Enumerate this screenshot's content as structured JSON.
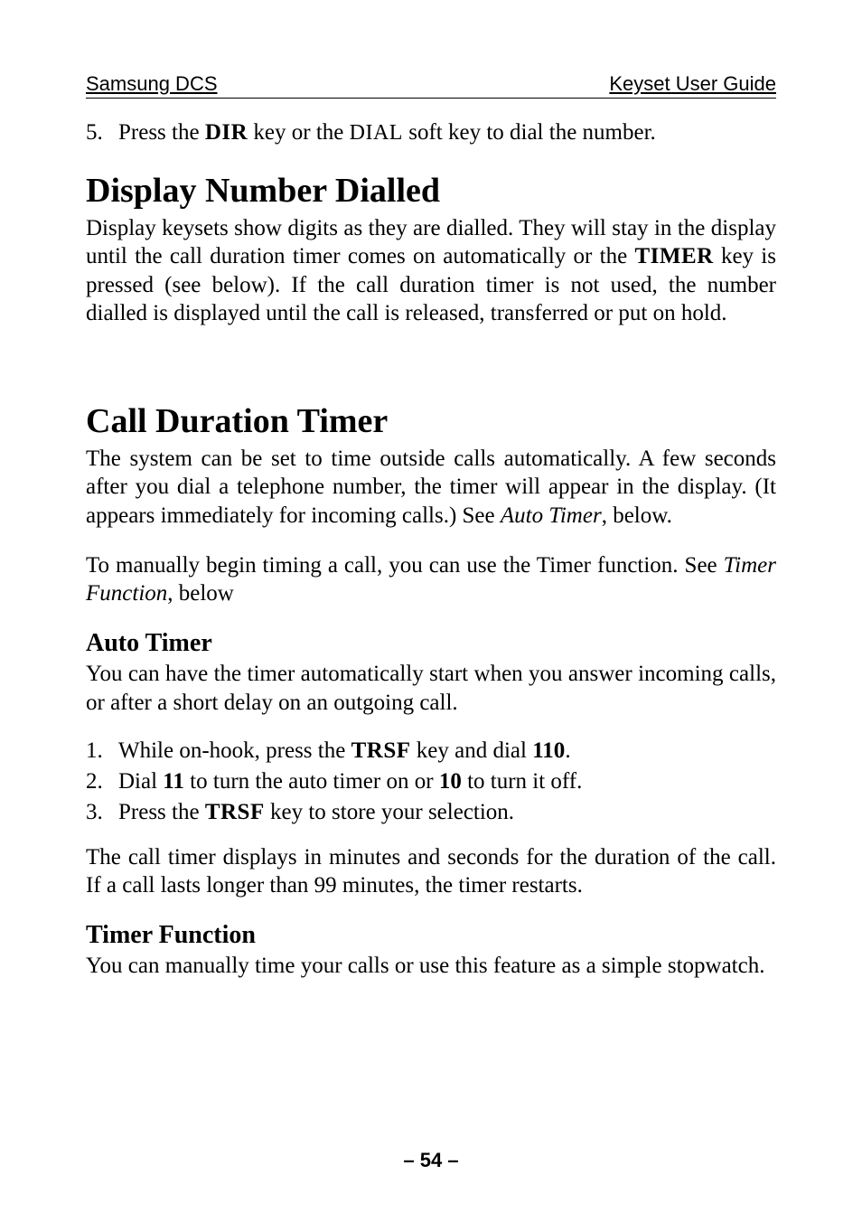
{
  "header": {
    "left": "Samsung DCS",
    "right": "Keyset User Guide"
  },
  "step5": {
    "num": "5.",
    "pre": "Press the ",
    "dir": "DIR",
    "mid": " key or the ",
    "dial": "DIAL",
    "post": " soft key to dial the number."
  },
  "section1": {
    "title": "Display Number Dialled",
    "para_pre": "Display keysets show digits as they are dialled. They will stay in the display until the call duration timer comes on automatically or the ",
    "timer": "TIMER",
    "para_post": " key is pressed (see below). If the call duration timer is not used, the number dialled is displayed until the call is released, transferred or put on hold."
  },
  "section2": {
    "title": "Call Duration Timer",
    "para1_pre": "The system can be set to time outside calls automatically. A few seconds after you dial a telephone number, the timer will appear in the display. (It appears immediately for incoming calls.) See ",
    "auto_timer_ref": "Auto Timer",
    "para1_post": ", below.",
    "para2_pre": "To manually begin timing a call, you can use the Timer function. See ",
    "timer_func_ref": "Timer Function",
    "para2_post": ", below"
  },
  "auto_timer": {
    "title": "Auto Timer",
    "para": "You can have the timer automatically start when you answer incoming calls, or after a short delay on an outgoing call.",
    "step1": {
      "num": "1.",
      "pre": "While on-hook, press the ",
      "trsf": "TRSF",
      "mid": " key and dial ",
      "code": "110",
      "post": "."
    },
    "step2": {
      "num": "2.",
      "pre": "Dial ",
      "code1": "11",
      "mid": " to turn the auto timer on or ",
      "code2": "10",
      "post": " to turn it off."
    },
    "step3": {
      "num": "3.",
      "pre": "Press the ",
      "trsf": "TRSF",
      "post": " key to store your selection."
    },
    "para2": "The call timer displays in minutes and seconds for the duration of the call. If a call lasts longer than 99 minutes, the timer restarts."
  },
  "timer_function": {
    "title": "Timer Function",
    "para": "You can manually time your calls or use this feature as a simple stopwatch."
  },
  "footer": "– 54 –"
}
